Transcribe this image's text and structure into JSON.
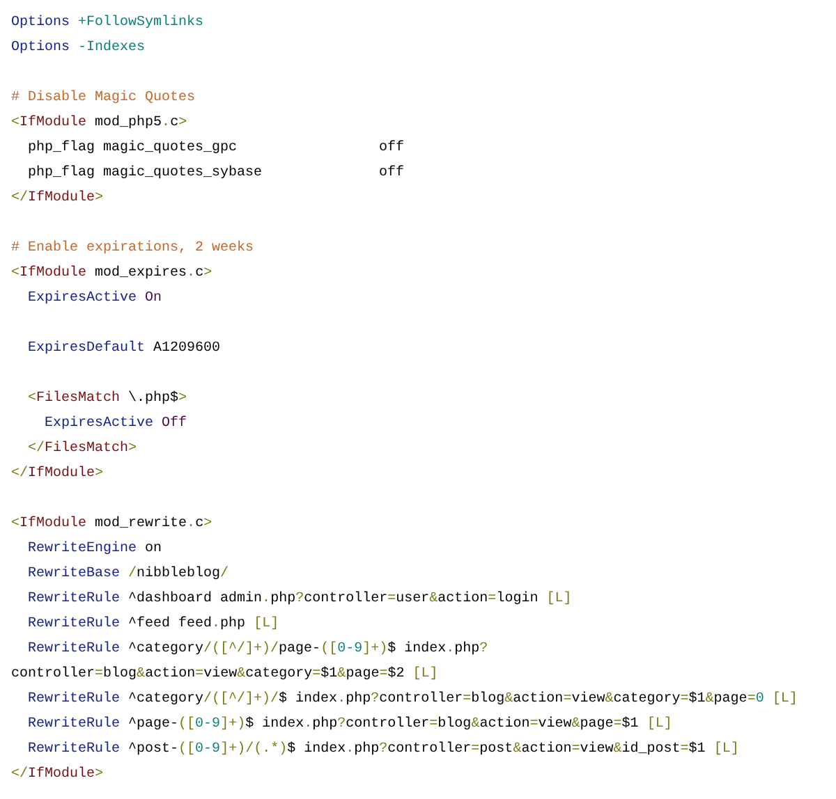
{
  "code_lines": [
    {
      "kind": "code",
      "tokens": [
        {
          "kind": "dir",
          "text": "Options"
        },
        {
          "kind": "val",
          "text": " +FollowSymlinks"
        }
      ]
    },
    {
      "kind": "code",
      "tokens": [
        {
          "kind": "dir",
          "text": "Options"
        },
        {
          "kind": "val",
          "text": " -Indexes"
        }
      ]
    },
    {
      "kind": "blank"
    },
    {
      "kind": "code",
      "tokens": [
        {
          "kind": "cmt",
          "text": "# Disable Magic Quotes"
        }
      ]
    },
    {
      "kind": "code",
      "tokens": [
        {
          "kind": "br",
          "text": "<"
        },
        {
          "kind": "tag",
          "text": "IfModule"
        },
        {
          "kind": "txt",
          "text": " mod_php5"
        },
        {
          "kind": "br",
          "text": "."
        },
        {
          "kind": "txt",
          "text": "c"
        },
        {
          "kind": "br",
          "text": ">"
        }
      ]
    },
    {
      "kind": "code",
      "tokens": [
        {
          "kind": "txt",
          "text": "  php_flag magic_quotes_gpc                 off"
        }
      ]
    },
    {
      "kind": "code",
      "tokens": [
        {
          "kind": "txt",
          "text": "  php_flag magic_quotes_sybase              off"
        }
      ]
    },
    {
      "kind": "code",
      "tokens": [
        {
          "kind": "br",
          "text": "</"
        },
        {
          "kind": "tag",
          "text": "IfModule"
        },
        {
          "kind": "br",
          "text": ">"
        }
      ]
    },
    {
      "kind": "blank"
    },
    {
      "kind": "code",
      "tokens": [
        {
          "kind": "cmt",
          "text": "# Enable expirations, 2 weeks"
        }
      ]
    },
    {
      "kind": "code",
      "tokens": [
        {
          "kind": "br",
          "text": "<"
        },
        {
          "kind": "tag",
          "text": "IfModule"
        },
        {
          "kind": "txt",
          "text": " mod_expires"
        },
        {
          "kind": "br",
          "text": "."
        },
        {
          "kind": "txt",
          "text": "c"
        },
        {
          "kind": "br",
          "text": ">"
        }
      ]
    },
    {
      "kind": "code",
      "tokens": [
        {
          "kind": "dir",
          "text": "  ExpiresActive"
        },
        {
          "kind": "kw",
          "text": " On"
        }
      ]
    },
    {
      "kind": "blank"
    },
    {
      "kind": "code",
      "tokens": [
        {
          "kind": "dir",
          "text": "  ExpiresDefault"
        },
        {
          "kind": "txt",
          "text": " A1209600"
        }
      ]
    },
    {
      "kind": "blank"
    },
    {
      "kind": "code",
      "tokens": [
        {
          "kind": "br",
          "text": "  <"
        },
        {
          "kind": "tag",
          "text": "FilesMatch"
        },
        {
          "kind": "txt",
          "text": " \\.php$"
        },
        {
          "kind": "br",
          "text": ">"
        }
      ]
    },
    {
      "kind": "code",
      "tokens": [
        {
          "kind": "dir",
          "text": "    ExpiresActive"
        },
        {
          "kind": "kw",
          "text": " Off"
        }
      ]
    },
    {
      "kind": "code",
      "tokens": [
        {
          "kind": "br",
          "text": "  </"
        },
        {
          "kind": "tag",
          "text": "FilesMatch"
        },
        {
          "kind": "br",
          "text": ">"
        }
      ]
    },
    {
      "kind": "code",
      "tokens": [
        {
          "kind": "br",
          "text": "</"
        },
        {
          "kind": "tag",
          "text": "IfModule"
        },
        {
          "kind": "br",
          "text": ">"
        }
      ]
    },
    {
      "kind": "blank"
    },
    {
      "kind": "code",
      "tokens": [
        {
          "kind": "br",
          "text": "<"
        },
        {
          "kind": "tag",
          "text": "IfModule"
        },
        {
          "kind": "txt",
          "text": " mod_rewrite"
        },
        {
          "kind": "br",
          "text": "."
        },
        {
          "kind": "txt",
          "text": "c"
        },
        {
          "kind": "br",
          "text": ">"
        }
      ]
    },
    {
      "kind": "code",
      "tokens": [
        {
          "kind": "dir",
          "text": "  RewriteEngine"
        },
        {
          "kind": "txt",
          "text": " on"
        }
      ]
    },
    {
      "kind": "code",
      "tokens": [
        {
          "kind": "dir",
          "text": "  RewriteBase"
        },
        {
          "kind": "br",
          "text": " /"
        },
        {
          "kind": "txt",
          "text": "nibbleblog"
        },
        {
          "kind": "br",
          "text": "/"
        }
      ]
    },
    {
      "kind": "code",
      "tokens": [
        {
          "kind": "dir",
          "text": "  RewriteRule"
        },
        {
          "kind": "txt",
          "text": " ^dashboard admin"
        },
        {
          "kind": "br",
          "text": "."
        },
        {
          "kind": "txt",
          "text": "php"
        },
        {
          "kind": "br",
          "text": "?"
        },
        {
          "kind": "txt",
          "text": "controller"
        },
        {
          "kind": "br",
          "text": "="
        },
        {
          "kind": "txt",
          "text": "user"
        },
        {
          "kind": "br",
          "text": "&"
        },
        {
          "kind": "txt",
          "text": "action"
        },
        {
          "kind": "br",
          "text": "="
        },
        {
          "kind": "txt",
          "text": "login"
        },
        {
          "kind": "br",
          "text": " [L]"
        }
      ]
    },
    {
      "kind": "code",
      "tokens": [
        {
          "kind": "dir",
          "text": "  RewriteRule"
        },
        {
          "kind": "txt",
          "text": " ^feed feed"
        },
        {
          "kind": "br",
          "text": "."
        },
        {
          "kind": "txt",
          "text": "php"
        },
        {
          "kind": "br",
          "text": " [L]"
        }
      ]
    },
    {
      "kind": "code",
      "tokens": [
        {
          "kind": "dir",
          "text": "  RewriteRule"
        },
        {
          "kind": "txt",
          "text": " ^category"
        },
        {
          "kind": "br",
          "text": "/([^/]+)/"
        },
        {
          "kind": "txt",
          "text": "page-"
        },
        {
          "kind": "br",
          "text": "(["
        },
        {
          "kind": "val",
          "text": "0-9"
        },
        {
          "kind": "br",
          "text": "]+)"
        },
        {
          "kind": "txt",
          "text": "$ index"
        },
        {
          "kind": "br",
          "text": "."
        },
        {
          "kind": "txt",
          "text": "php"
        },
        {
          "kind": "br",
          "text": "?"
        }
      ]
    },
    {
      "kind": "code",
      "tokens": [
        {
          "kind": "txt",
          "text": "controller"
        },
        {
          "kind": "br",
          "text": "="
        },
        {
          "kind": "txt",
          "text": "blog"
        },
        {
          "kind": "br",
          "text": "&"
        },
        {
          "kind": "txt",
          "text": "action"
        },
        {
          "kind": "br",
          "text": "="
        },
        {
          "kind": "txt",
          "text": "view"
        },
        {
          "kind": "br",
          "text": "&"
        },
        {
          "kind": "txt",
          "text": "category"
        },
        {
          "kind": "br",
          "text": "="
        },
        {
          "kind": "txt",
          "text": "$1"
        },
        {
          "kind": "br",
          "text": "&"
        },
        {
          "kind": "txt",
          "text": "page"
        },
        {
          "kind": "br",
          "text": "="
        },
        {
          "kind": "txt",
          "text": "$2"
        },
        {
          "kind": "br",
          "text": " [L]"
        }
      ]
    },
    {
      "kind": "code",
      "tokens": [
        {
          "kind": "dir",
          "text": "  RewriteRule"
        },
        {
          "kind": "txt",
          "text": " ^category"
        },
        {
          "kind": "br",
          "text": "/([^/]+)/"
        },
        {
          "kind": "txt",
          "text": "$ index"
        },
        {
          "kind": "br",
          "text": "."
        },
        {
          "kind": "txt",
          "text": "php"
        },
        {
          "kind": "br",
          "text": "?"
        },
        {
          "kind": "txt",
          "text": "controller"
        },
        {
          "kind": "br",
          "text": "="
        },
        {
          "kind": "txt",
          "text": "blog"
        },
        {
          "kind": "br",
          "text": "&"
        },
        {
          "kind": "txt",
          "text": "action"
        },
        {
          "kind": "br",
          "text": "="
        },
        {
          "kind": "txt",
          "text": "view"
        },
        {
          "kind": "br",
          "text": "&"
        },
        {
          "kind": "txt",
          "text": "category"
        },
        {
          "kind": "br",
          "text": "="
        },
        {
          "kind": "txt",
          "text": "$1"
        },
        {
          "kind": "br",
          "text": "&"
        },
        {
          "kind": "txt",
          "text": "page"
        },
        {
          "kind": "br",
          "text": "="
        },
        {
          "kind": "val",
          "text": "0"
        },
        {
          "kind": "br",
          "text": " [L]"
        }
      ]
    },
    {
      "kind": "code",
      "tokens": [
        {
          "kind": "dir",
          "text": "  RewriteRule"
        },
        {
          "kind": "txt",
          "text": " ^page-"
        },
        {
          "kind": "br",
          "text": "(["
        },
        {
          "kind": "val",
          "text": "0-9"
        },
        {
          "kind": "br",
          "text": "]+)"
        },
        {
          "kind": "txt",
          "text": "$ index"
        },
        {
          "kind": "br",
          "text": "."
        },
        {
          "kind": "txt",
          "text": "php"
        },
        {
          "kind": "br",
          "text": "?"
        },
        {
          "kind": "txt",
          "text": "controller"
        },
        {
          "kind": "br",
          "text": "="
        },
        {
          "kind": "txt",
          "text": "blog"
        },
        {
          "kind": "br",
          "text": "&"
        },
        {
          "kind": "txt",
          "text": "action"
        },
        {
          "kind": "br",
          "text": "="
        },
        {
          "kind": "txt",
          "text": "view"
        },
        {
          "kind": "br",
          "text": "&"
        },
        {
          "kind": "txt",
          "text": "page"
        },
        {
          "kind": "br",
          "text": "="
        },
        {
          "kind": "txt",
          "text": "$1"
        },
        {
          "kind": "br",
          "text": " [L]"
        }
      ]
    },
    {
      "kind": "code",
      "tokens": [
        {
          "kind": "dir",
          "text": "  RewriteRule"
        },
        {
          "kind": "txt",
          "text": " ^post-"
        },
        {
          "kind": "br",
          "text": "(["
        },
        {
          "kind": "val",
          "text": "0-9"
        },
        {
          "kind": "br",
          "text": "]+)/(.*)"
        },
        {
          "kind": "txt",
          "text": "$ index"
        },
        {
          "kind": "br",
          "text": "."
        },
        {
          "kind": "txt",
          "text": "php"
        },
        {
          "kind": "br",
          "text": "?"
        },
        {
          "kind": "txt",
          "text": "controller"
        },
        {
          "kind": "br",
          "text": "="
        },
        {
          "kind": "txt",
          "text": "post"
        },
        {
          "kind": "br",
          "text": "&"
        },
        {
          "kind": "txt",
          "text": "action"
        },
        {
          "kind": "br",
          "text": "="
        },
        {
          "kind": "txt",
          "text": "view"
        },
        {
          "kind": "br",
          "text": "&"
        },
        {
          "kind": "txt",
          "text": "id_post"
        },
        {
          "kind": "br",
          "text": "="
        },
        {
          "kind": "txt",
          "text": "$1"
        },
        {
          "kind": "br",
          "text": " [L]"
        }
      ]
    },
    {
      "kind": "code",
      "tokens": [
        {
          "kind": "br",
          "text": "</"
        },
        {
          "kind": "tag",
          "text": "IfModule"
        },
        {
          "kind": "br",
          "text": ">"
        }
      ]
    }
  ]
}
